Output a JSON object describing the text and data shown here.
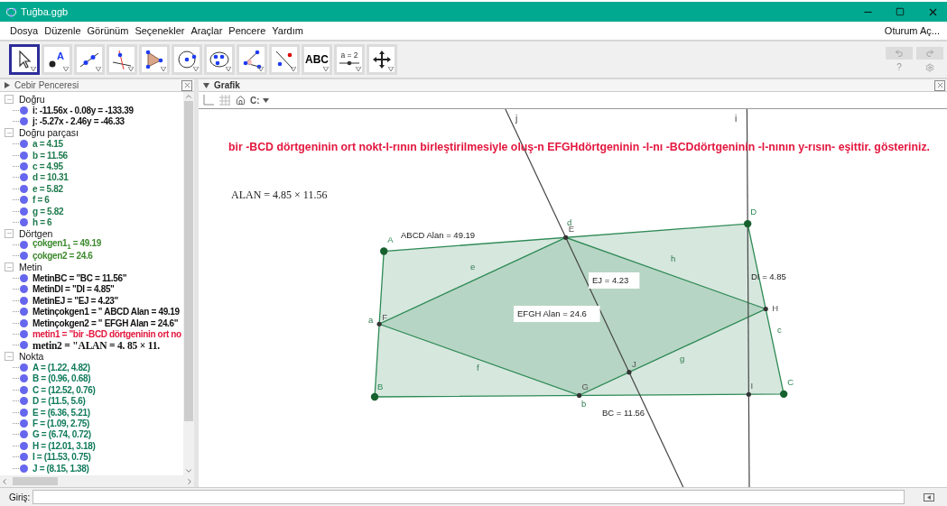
{
  "window": {
    "title": "Tuğba.ggb"
  },
  "menu": {
    "items": [
      "Dosya",
      "Düzenle",
      "Görünüm",
      "Seçenekler",
      "Araçlar",
      "Pencere",
      "Yardım"
    ],
    "sign_in": "Oturum Aç..."
  },
  "toolbar": {
    "tools": [
      {
        "kind": "move",
        "selected": true
      },
      {
        "kind": "point",
        "label": "A",
        "selected": false
      },
      {
        "kind": "line",
        "selected": false
      },
      {
        "kind": "perpendicular",
        "selected": false
      },
      {
        "kind": "polygon",
        "selected": false
      },
      {
        "kind": "circle",
        "selected": false
      },
      {
        "kind": "ellipse",
        "selected": false
      },
      {
        "kind": "angle",
        "selected": false
      },
      {
        "kind": "reflect",
        "selected": false
      },
      {
        "kind": "text",
        "label": "ABC",
        "selected": false
      },
      {
        "kind": "slider",
        "label": "a = 2",
        "selected": false
      },
      {
        "kind": "pan",
        "selected": false
      }
    ],
    "help": "?"
  },
  "algebra": {
    "title": "Cebir Penceresi",
    "groups": [
      {
        "name": "Doğru",
        "expanded": true,
        "items": [
          {
            "text": "i: -11.56x - 0.08y = -133.39",
            "color": "#111111"
          },
          {
            "text": "j: -5.27x - 2.46y = -46.33",
            "color": "#111111"
          }
        ]
      },
      {
        "name": "Doğru parçası",
        "expanded": true,
        "items": [
          {
            "text": "a = 4.15",
            "color": "#1e7a4c"
          },
          {
            "text": "b = 11.56",
            "color": "#1e7a4c"
          },
          {
            "text": "c = 4.95",
            "color": "#1e7a4c"
          },
          {
            "text": "d = 10.31",
            "color": "#1e7a4c"
          },
          {
            "text": "e = 5.82",
            "color": "#1e7a4c"
          },
          {
            "text": "f = 6",
            "color": "#1e7a4c"
          },
          {
            "text": "g = 5.82",
            "color": "#1e7a4c"
          },
          {
            "text": "h = 6",
            "color": "#1e7a4c"
          }
        ]
      },
      {
        "name": "Dörtgen",
        "expanded": true,
        "items": [
          {
            "text": "çokgen1$_{1}$ = 49.19",
            "color": "#3d8a2e"
          },
          {
            "text": "çokgen2 = 24.6",
            "color": "#3d8a2e"
          }
        ]
      },
      {
        "name": "Metin",
        "expanded": true,
        "items": [
          {
            "text": "MetinBC = \"BC = 11.56\"",
            "color": "#111111"
          },
          {
            "text": "MetinDI = \"DI = 4.85\"",
            "color": "#111111"
          },
          {
            "text": "MetinEJ = \"EJ = 4.23\"",
            "color": "#111111"
          },
          {
            "text": "Metinçokgen1 = \" ABCD Alan = 49.19",
            "color": "#111111"
          },
          {
            "text": "Metinçokgen2 = \" EFGH Alan = 24.6\"",
            "color": "#111111"
          },
          {
            "text": "metin1 = \"bir -BCD dörtgeninin ort no",
            "color": "#e3173e"
          },
          {
            "text": "metin2 = \"ALAN = 4. 85 × 11.",
            "color": "#111111",
            "kind": "math"
          }
        ]
      },
      {
        "name": "Nokta",
        "expanded": true,
        "items": [
          {
            "text": "A = (1.22, 4.82)",
            "color": "#0f7a5a"
          },
          {
            "text": "B = (0.96, 0.68)",
            "color": "#0f7a5a"
          },
          {
            "text": "C = (12.52, 0.76)",
            "color": "#0f7a5a"
          },
          {
            "text": "D = (11.5, 5.6)",
            "color": "#0f7a5a"
          },
          {
            "text": "E = (6.36, 5.21)",
            "color": "#0f7a5a"
          },
          {
            "text": "F = (1.09, 2.75)",
            "color": "#0f7a5a"
          },
          {
            "text": "G = (6.74, 0.72)",
            "color": "#0f7a5a"
          },
          {
            "text": "H = (12.01, 3.18)",
            "color": "#0f7a5a"
          },
          {
            "text": "I = (11.53, 0.75)",
            "color": "#0f7a5a"
          },
          {
            "text": "J = (8.15, 1.38)",
            "color": "#0f7a5a"
          }
        ]
      }
    ]
  },
  "graphics": {
    "title": "Grafik",
    "capture": "C:",
    "heading": "bir -BCD dörtgeninin ort nokt-l-rının birleştirilmesiyle oluş-n EFGHdörtgeninin -l-nı -BCDdörtgeninin -l-nının y-rısın- eşittir. gösteriniz.",
    "formula": "ALAN = 4.85 × 11.56",
    "lines": [
      {
        "label": "j"
      },
      {
        "label": "i"
      }
    ],
    "segment_labels": [
      "e",
      "h",
      "f",
      "g",
      "c",
      "d",
      "a",
      "b"
    ],
    "points": [
      {
        "label": "A",
        "kind": "free"
      },
      {
        "label": "B",
        "kind": "free"
      },
      {
        "label": "C",
        "kind": "free"
      },
      {
        "label": "D",
        "kind": "free"
      },
      {
        "label": "E",
        "kind": "dependent"
      },
      {
        "label": "F",
        "kind": "dependent"
      },
      {
        "label": "G",
        "kind": "dependent"
      },
      {
        "label": "H",
        "kind": "dependent"
      },
      {
        "label": "I",
        "kind": "dependent"
      },
      {
        "label": "J",
        "kind": "dependent"
      }
    ],
    "captions": [
      {
        "text": "ABCD Alan = 49.19",
        "boxed": false
      },
      {
        "text": "EJ = 4.23",
        "boxed": true
      },
      {
        "text": "DI = 4.85",
        "boxed": false
      },
      {
        "text": "EFGH Alan = 24.6",
        "boxed": true
      },
      {
        "text": "BC = 11.56",
        "boxed": false
      }
    ]
  },
  "input": {
    "label": "Giriş:"
  }
}
